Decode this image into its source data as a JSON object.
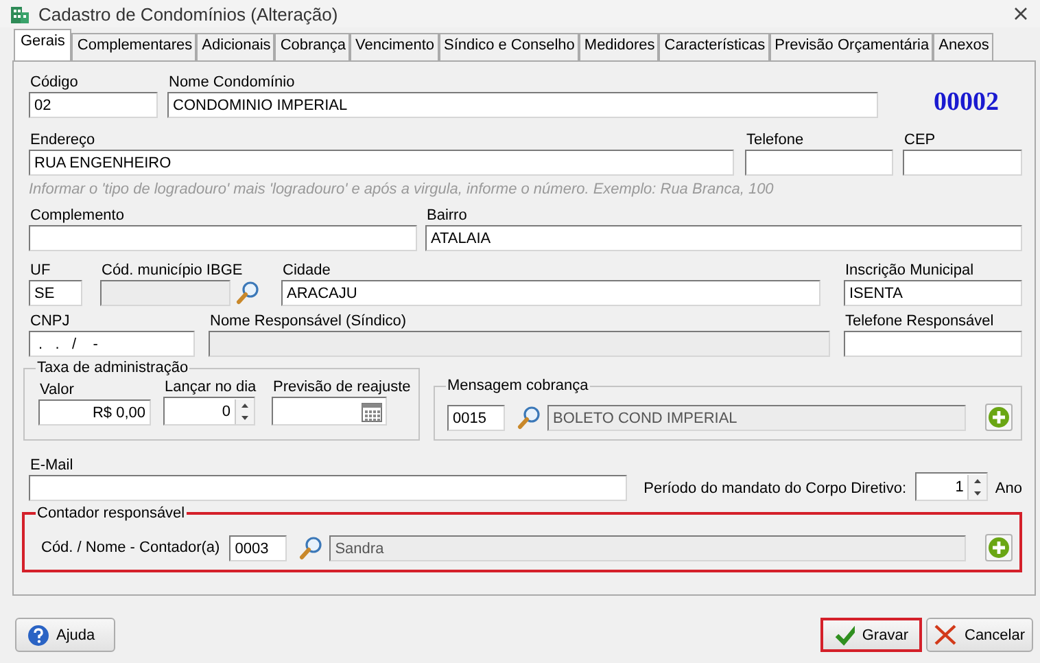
{
  "window": {
    "title": "Cadastro de Condomínios (Alteração)"
  },
  "tabs": [
    {
      "label": "Gerais",
      "selected": true
    },
    {
      "label": "Complementares",
      "selected": false
    },
    {
      "label": "Adicionais",
      "selected": false
    },
    {
      "label": "Cobrança",
      "selected": false
    },
    {
      "label": "Vencimento",
      "selected": false
    },
    {
      "label": "Síndico e Conselho",
      "selected": false
    },
    {
      "label": "Medidores",
      "selected": false
    },
    {
      "label": "Características",
      "selected": false
    },
    {
      "label": "Previsão Orçamentária",
      "selected": false
    },
    {
      "label": "Anexos",
      "selected": false
    }
  ],
  "codigo": {
    "label": "Código",
    "value": "02"
  },
  "nome_condominio": {
    "label": "Nome Condomínio",
    "value": "CONDOMINIO IMPERIAL"
  },
  "record_number": "00002",
  "endereco": {
    "label": "Endereço",
    "value": "RUA ENGENHEIRO"
  },
  "telefone": {
    "label": "Telefone"
  },
  "cep": {
    "label": "CEP"
  },
  "address_hint": "Informar o 'tipo de logradouro' mais 'logradouro' e após a virgula, informe o número. Exemplo: Rua Branca, 100",
  "complemento": {
    "label": "Complemento"
  },
  "bairro": {
    "label": "Bairro",
    "value": "ATALAIA"
  },
  "uf": {
    "label": "UF",
    "value": "SE"
  },
  "cod_municipio_ibge": {
    "label": "Cód. município IBGE",
    "disabled": true
  },
  "cidade": {
    "label": "Cidade",
    "value": "ARACAJU"
  },
  "inscricao_municipal": {
    "label": "Inscrição Municipal",
    "value": "ISENTA"
  },
  "cnpj": {
    "label": "CNPJ",
    "value": " .   .   /    -"
  },
  "nome_responsavel": {
    "label": "Nome Responsável (Síndico)",
    "disabled": true
  },
  "telefone_responsavel": {
    "label": "Telefone Responsável"
  },
  "taxa_administracao": {
    "title": "Taxa de administração",
    "valor": {
      "label": "Valor",
      "value": "R$ 0,00"
    },
    "lancar_no_dia": {
      "label": "Lançar no dia",
      "value": "0"
    },
    "previsao_reajuste": {
      "label": "Previsão de reajuste"
    }
  },
  "mensagem_cobranca": {
    "title": "Mensagem cobrança",
    "code": "0015",
    "description": "BOLETO COND IMPERIAL"
  },
  "email": {
    "label": "E-Mail"
  },
  "periodo_mandato": {
    "label": "Período do mandato do Corpo Diretivo:",
    "value": "1",
    "unit": "Ano"
  },
  "contador": {
    "title": "Contador responsável",
    "label": "Cód. / Nome - Contador(a)",
    "code": "0003",
    "name": "Sandra",
    "highlighted": true
  },
  "buttons": [
    {
      "kind": "help",
      "label": "Ajuda",
      "highlighted": false
    },
    {
      "kind": "save",
      "label": "Gravar",
      "highlighted": true
    },
    {
      "kind": "cancel",
      "label": "Cancelar",
      "highlighted": false
    }
  ]
}
